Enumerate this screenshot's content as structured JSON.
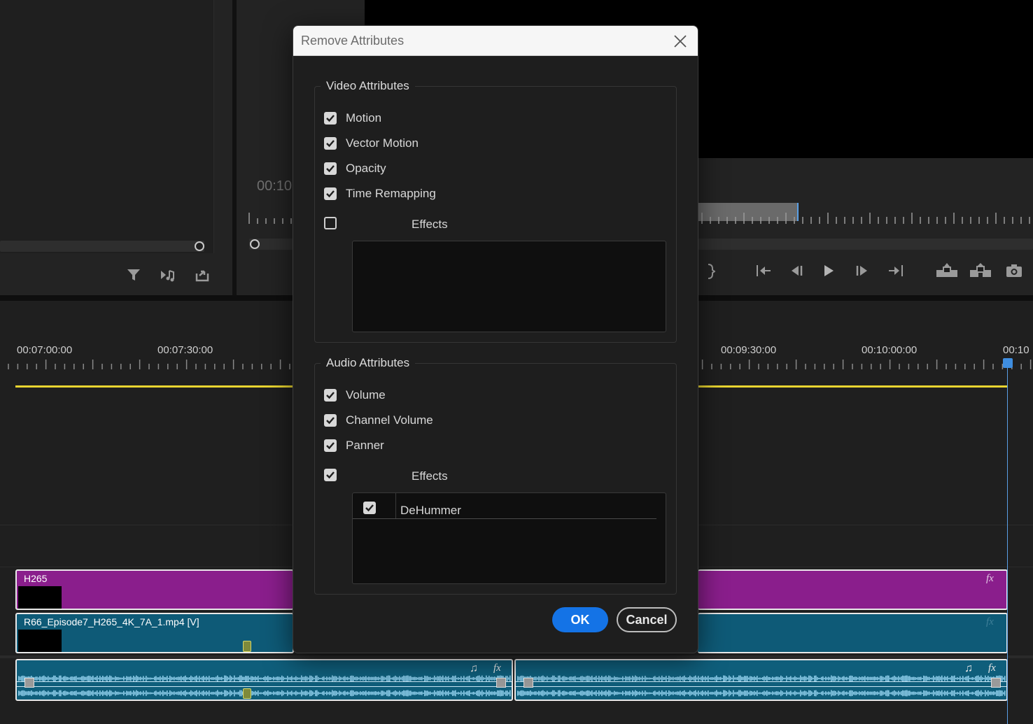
{
  "dialog": {
    "title": "Remove Attributes",
    "video_group": {
      "legend": "Video Attributes",
      "items": [
        {
          "label": "Motion",
          "checked": true
        },
        {
          "label": "Vector Motion",
          "checked": true
        },
        {
          "label": "Opacity",
          "checked": true
        },
        {
          "label": "Time Remapping",
          "checked": true
        }
      ],
      "effects_label": "Effects",
      "effects_checked": false
    },
    "audio_group": {
      "legend": "Audio Attributes",
      "items": [
        {
          "label": "Volume",
          "checked": true
        },
        {
          "label": "Channel Volume",
          "checked": true
        },
        {
          "label": "Panner",
          "checked": true
        }
      ],
      "effects_label": "Effects",
      "effects_checked": true,
      "effects_list": [
        {
          "label": "DeHummer",
          "checked": true
        }
      ]
    },
    "ok_label": "OK",
    "cancel_label": "Cancel"
  },
  "source_monitor": {
    "timecode_partial": "00:10"
  },
  "timeline": {
    "ruler_labels": [
      "00:07:00:00",
      "00:07:30:00",
      "00:09:30:00",
      "00:10:00:00",
      "00:10"
    ],
    "clips": {
      "v2_name": "H265",
      "v1_name": "R66_Episode7_H265_4K_7A_1.mp4 [V]"
    },
    "fx_badge": "fx"
  },
  "colors": {
    "accent": "#1473e6",
    "v2_clip": "#8a1e8c",
    "v1_clip": "#0e5a77",
    "audio_clip": "#0f5e7b",
    "work_area_bar": "#e9d530",
    "playhead": "#5aa0e6"
  },
  "icons": {
    "filter": "filter-icon",
    "insert": "insert-icon",
    "export": "export-icon",
    "step_back": "go-to-in-icon",
    "frame_back": "step-back-icon",
    "play": "play-icon",
    "frame_forward": "step-forward-icon",
    "go_to_out": "go-to-out-icon",
    "lift": "lift-icon",
    "extract": "extract-icon",
    "camera": "export-frame-icon",
    "music": "music-note-icon"
  }
}
